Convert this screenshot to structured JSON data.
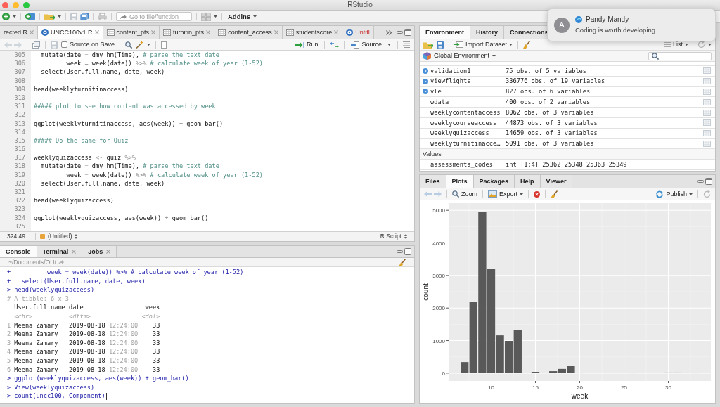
{
  "window": {
    "title": "RStudio"
  },
  "toolbar": {
    "search": {
      "placeholder": "Go to file/function"
    },
    "addins": "Addins"
  },
  "notification": {
    "avatar_initial": "A",
    "sender": "Pandy Mandy",
    "message": "Coding is worth developing"
  },
  "editor": {
    "tabs": [
      {
        "label": "rected.R",
        "selected": false,
        "modified": false,
        "closable": true
      },
      {
        "label": "UNCC100v1.R",
        "kind": "script",
        "selected": true,
        "modified": false,
        "closable": true
      },
      {
        "label": "content_pts",
        "kind": "data",
        "selected": false,
        "modified": false,
        "closable": true
      },
      {
        "label": "turnitin_pts",
        "kind": "data",
        "selected": false,
        "modified": false,
        "closable": true
      },
      {
        "label": "content_access",
        "kind": "data",
        "selected": false,
        "modified": false,
        "closable": true
      },
      {
        "label": "studentscore",
        "kind": "data",
        "selected": false,
        "modified": false,
        "closable": true
      },
      {
        "label": "Untitl",
        "kind": "script",
        "selected": false,
        "modified": true,
        "closable": false
      }
    ],
    "source_on_save": {
      "label": "Source on Save",
      "checked": false
    },
    "run": "Run",
    "source": "Source",
    "lines": [
      {
        "number": "305",
        "tokens": [
          {
            "kind": "code",
            "text": "  mutate(date "
          },
          {
            "kind": "op",
            "text": "="
          },
          {
            "kind": "code",
            "text": " dmy_hm(Time), "
          },
          {
            "kind": "comment",
            "text": "# parse the text date"
          }
        ]
      },
      {
        "number": "306",
        "tokens": [
          {
            "kind": "code",
            "text": "         week "
          },
          {
            "kind": "op",
            "text": "="
          },
          {
            "kind": "code",
            "text": " week(date)) "
          },
          {
            "kind": "op",
            "text": "%>% "
          },
          {
            "kind": "comment",
            "text": "# calculate week of year (1-52)"
          }
        ]
      },
      {
        "number": "307",
        "tokens": [
          {
            "kind": "code",
            "text": "  select(User.full.name, date, week)"
          }
        ]
      },
      {
        "number": "308"
      },
      {
        "number": "309",
        "tokens": [
          {
            "kind": "code",
            "text": "head(weeklyturnitinaccess)"
          }
        ]
      },
      {
        "number": "310"
      },
      {
        "number": "311",
        "tokens": [
          {
            "kind": "comment",
            "text": "##### plot to see how content was accessed by week"
          }
        ]
      },
      {
        "number": "312"
      },
      {
        "number": "313",
        "tokens": [
          {
            "kind": "code",
            "text": "ggplot(weeklyturnitinaccess, aes(week)) "
          },
          {
            "kind": "op",
            "text": "+"
          },
          {
            "kind": "code",
            "text": " geom_bar()"
          }
        ]
      },
      {
        "number": "314"
      },
      {
        "number": "315",
        "tokens": [
          {
            "kind": "comment",
            "text": "##### Do the same for Quiz"
          }
        ]
      },
      {
        "number": "316"
      },
      {
        "number": "317",
        "tokens": [
          {
            "kind": "code",
            "text": "weeklyquizaccess "
          },
          {
            "kind": "op",
            "text": "<-"
          },
          {
            "kind": "code",
            "text": " quiz "
          },
          {
            "kind": "op",
            "text": "%>%"
          }
        ]
      },
      {
        "number": "318",
        "tokens": [
          {
            "kind": "code",
            "text": "  mutate(date "
          },
          {
            "kind": "op",
            "text": "="
          },
          {
            "kind": "code",
            "text": " dmy_hm(Time), "
          },
          {
            "kind": "comment",
            "text": "# parse the text date"
          }
        ]
      },
      {
        "number": "319",
        "tokens": [
          {
            "kind": "code",
            "text": "         week "
          },
          {
            "kind": "op",
            "text": "="
          },
          {
            "kind": "code",
            "text": " week(date)) "
          },
          {
            "kind": "op",
            "text": "%>% "
          },
          {
            "kind": "comment",
            "text": "# calculate week of year (1-52)"
          }
        ]
      },
      {
        "number": "320",
        "tokens": [
          {
            "kind": "code",
            "text": "  select(User.full.name, date, week)"
          }
        ]
      },
      {
        "number": "321"
      },
      {
        "number": "322",
        "tokens": [
          {
            "kind": "code",
            "text": "head(weeklyquizaccess)"
          }
        ]
      },
      {
        "number": "323"
      },
      {
        "number": "324",
        "tokens": [
          {
            "kind": "code",
            "text": "ggplot(weeklyquizaccess, aes(week)) "
          },
          {
            "kind": "op",
            "text": "+"
          },
          {
            "kind": "code",
            "text": " geom_bar()"
          }
        ]
      },
      {
        "number": "325"
      }
    ],
    "status": {
      "position": "324:49",
      "scope": "(Untitled)",
      "file_type": "R Script"
    }
  },
  "console": {
    "tabs": [
      {
        "label": "Console",
        "selected": true,
        "closable": false
      },
      {
        "label": "Terminal",
        "selected": false,
        "closable": true
      },
      {
        "label": "Jobs",
        "selected": false,
        "closable": true
      }
    ],
    "path": "~/Documents/OU/",
    "lines": [
      {
        "tokens": [
          {
            "kind": "input",
            "text": "+          week = week(date)) %>% # calculate week of year (1-52)"
          }
        ]
      },
      {
        "tokens": [
          {
            "kind": "input",
            "text": "+   select(User.full.name, date, week)"
          }
        ]
      },
      {
        "tokens": [
          {
            "kind": "input",
            "text": "> head(weeklyquizaccess)"
          }
        ]
      },
      {
        "tokens": [
          {
            "kind": "muted",
            "text": "# A tibble: 6 x 3"
          }
        ]
      },
      {
        "tokens": [
          {
            "kind": "output",
            "text": "  User.full.name date                 week"
          }
        ]
      },
      {
        "tokens": [
          {
            "kind": "type",
            "text": "  <chr>          <dttm>              <dbl>"
          }
        ]
      },
      {
        "tokens": [
          {
            "kind": "muted",
            "text": "1"
          },
          {
            "kind": "output",
            "text": " Meena Zamary   2019-08-18 "
          },
          {
            "kind": "muted",
            "text": "12:24:00"
          },
          {
            "kind": "output",
            "text": "    33"
          }
        ]
      },
      {
        "tokens": [
          {
            "kind": "muted",
            "text": "2"
          },
          {
            "kind": "output",
            "text": " Meena Zamary   2019-08-18 "
          },
          {
            "kind": "muted",
            "text": "12:24:00"
          },
          {
            "kind": "output",
            "text": "    33"
          }
        ]
      },
      {
        "tokens": [
          {
            "kind": "muted",
            "text": "3"
          },
          {
            "kind": "output",
            "text": " Meena Zamary   2019-08-18 "
          },
          {
            "kind": "muted",
            "text": "12:24:00"
          },
          {
            "kind": "output",
            "text": "    33"
          }
        ]
      },
      {
        "tokens": [
          {
            "kind": "muted",
            "text": "4"
          },
          {
            "kind": "output",
            "text": " Meena Zamary   2019-08-18 "
          },
          {
            "kind": "muted",
            "text": "12:24:00"
          },
          {
            "kind": "output",
            "text": "    33"
          }
        ]
      },
      {
        "tokens": [
          {
            "kind": "muted",
            "text": "5"
          },
          {
            "kind": "output",
            "text": " Meena Zamary   2019-08-18 "
          },
          {
            "kind": "muted",
            "text": "12:24:00"
          },
          {
            "kind": "output",
            "text": "    33"
          }
        ]
      },
      {
        "tokens": [
          {
            "kind": "muted",
            "text": "6"
          },
          {
            "kind": "output",
            "text": " Meena Zamary   2019-08-18 "
          },
          {
            "kind": "muted",
            "text": "12:24:00"
          },
          {
            "kind": "output",
            "text": "    33"
          }
        ]
      },
      {
        "tokens": [
          {
            "kind": "input",
            "text": "> ggplot(weeklyquizaccess, aes(week)) + geom_bar()"
          }
        ]
      },
      {
        "tokens": [
          {
            "kind": "input",
            "text": "> View(weeklyquizaccess)"
          }
        ]
      },
      {
        "tokens": [
          {
            "kind": "input",
            "text": "> count(uncc100, Component)"
          }
        ]
      }
    ]
  },
  "environment": {
    "tabs": [
      {
        "label": "Environment",
        "selected": true
      },
      {
        "label": "History",
        "selected": false
      },
      {
        "label": "Connections",
        "selected": false
      }
    ],
    "import_dataset": "Import Dataset",
    "view_mode": "List",
    "scope": "Global Environment",
    "rows": [
      {
        "name": "validation1",
        "value": "75 obs. of 5 variables",
        "expandable": true
      },
      {
        "name": "viewflights",
        "value": "336776 obs. of 19 variables",
        "expandable": true
      },
      {
        "name": "vle",
        "value": "827 obs. of 6 variables",
        "expandable": true
      },
      {
        "name": "wdata",
        "value": "400 obs. of 2 variables",
        "expandable": false
      },
      {
        "name": "weeklycontentaccess",
        "value": "8062 obs. of 3 variables",
        "expandable": false
      },
      {
        "name": "weeklycourseaccess",
        "value": "44873 obs. of 3 variables",
        "expandable": false
      },
      {
        "name": "weeklyquizaccess",
        "value": "14659 obs. of 3 variables",
        "expandable": false
      },
      {
        "name": "weeklyturnitinacce…",
        "value": "5091 obs. of 3 variables",
        "expandable": false
      }
    ],
    "values_heading": "Values",
    "values": [
      {
        "name": "assessments_codes",
        "value": "int [1:4] 25362 25348 25363 25349"
      }
    ]
  },
  "files": {
    "tabs": [
      {
        "label": "Files",
        "selected": false
      },
      {
        "label": "Plots",
        "selected": true
      },
      {
        "label": "Packages",
        "selected": false
      },
      {
        "label": "Help",
        "selected": false
      },
      {
        "label": "Viewer",
        "selected": false
      }
    ],
    "zoom": "Zoom",
    "export": "Export",
    "publish": "Publish",
    "plot": {
      "chart_data": {
        "type": "bar",
        "xlabel": "week",
        "ylabel": "count",
        "x": [
          7,
          8,
          9,
          10,
          11,
          12,
          13,
          15,
          16,
          17,
          18,
          19,
          20,
          26,
          30,
          31,
          33
        ],
        "values": [
          340,
          2190,
          4960,
          3210,
          1160,
          990,
          1320,
          40,
          10,
          60,
          130,
          220,
          10,
          10,
          20,
          20,
          10
        ],
        "xlim": [
          5.2,
          34.8
        ],
        "ylim": [
          -240,
          5220
        ],
        "xticks": [
          10,
          15,
          20,
          25,
          30
        ],
        "yticks": [
          0,
          1000,
          2000,
          3000,
          4000,
          5000
        ],
        "grid": true
      }
    }
  }
}
